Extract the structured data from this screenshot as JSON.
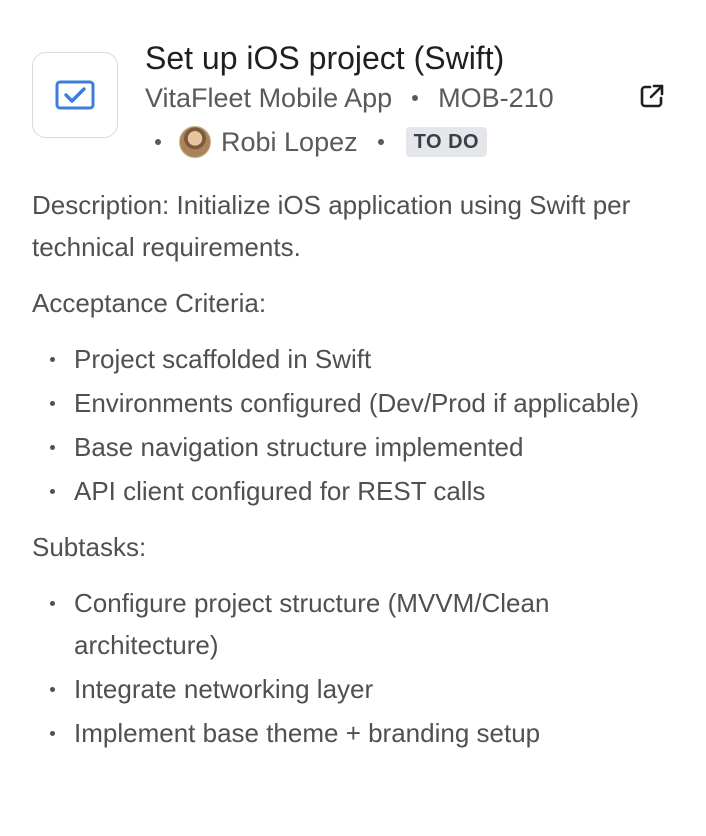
{
  "issue": {
    "title": "Set up iOS project (Swift)",
    "project": "VitaFleet Mobile App",
    "key": "MOB-210",
    "assignee": "Robi Lopez",
    "status": "TO DO",
    "type_icon": "checkbox-task-icon",
    "external_link_icon": "external-link-icon"
  },
  "colors": {
    "task_icon": "#3b7ddd",
    "status_badge_bg": "#e4e6ea"
  },
  "description": "Description: Initialize iOS application using Swift per technical requirements.",
  "acceptance": {
    "label": "Acceptance Criteria:",
    "items": [
      "Project scaffolded in Swift",
      "Environments configured (Dev/Prod if applicable)",
      "Base navigation structure implemented",
      "API client configured for REST calls"
    ]
  },
  "subtasks": {
    "label": "Subtasks:",
    "items": [
      "Configure project structure (MVVM/Clean architecture)",
      "Integrate networking layer",
      "Implement base theme + branding setup"
    ]
  }
}
